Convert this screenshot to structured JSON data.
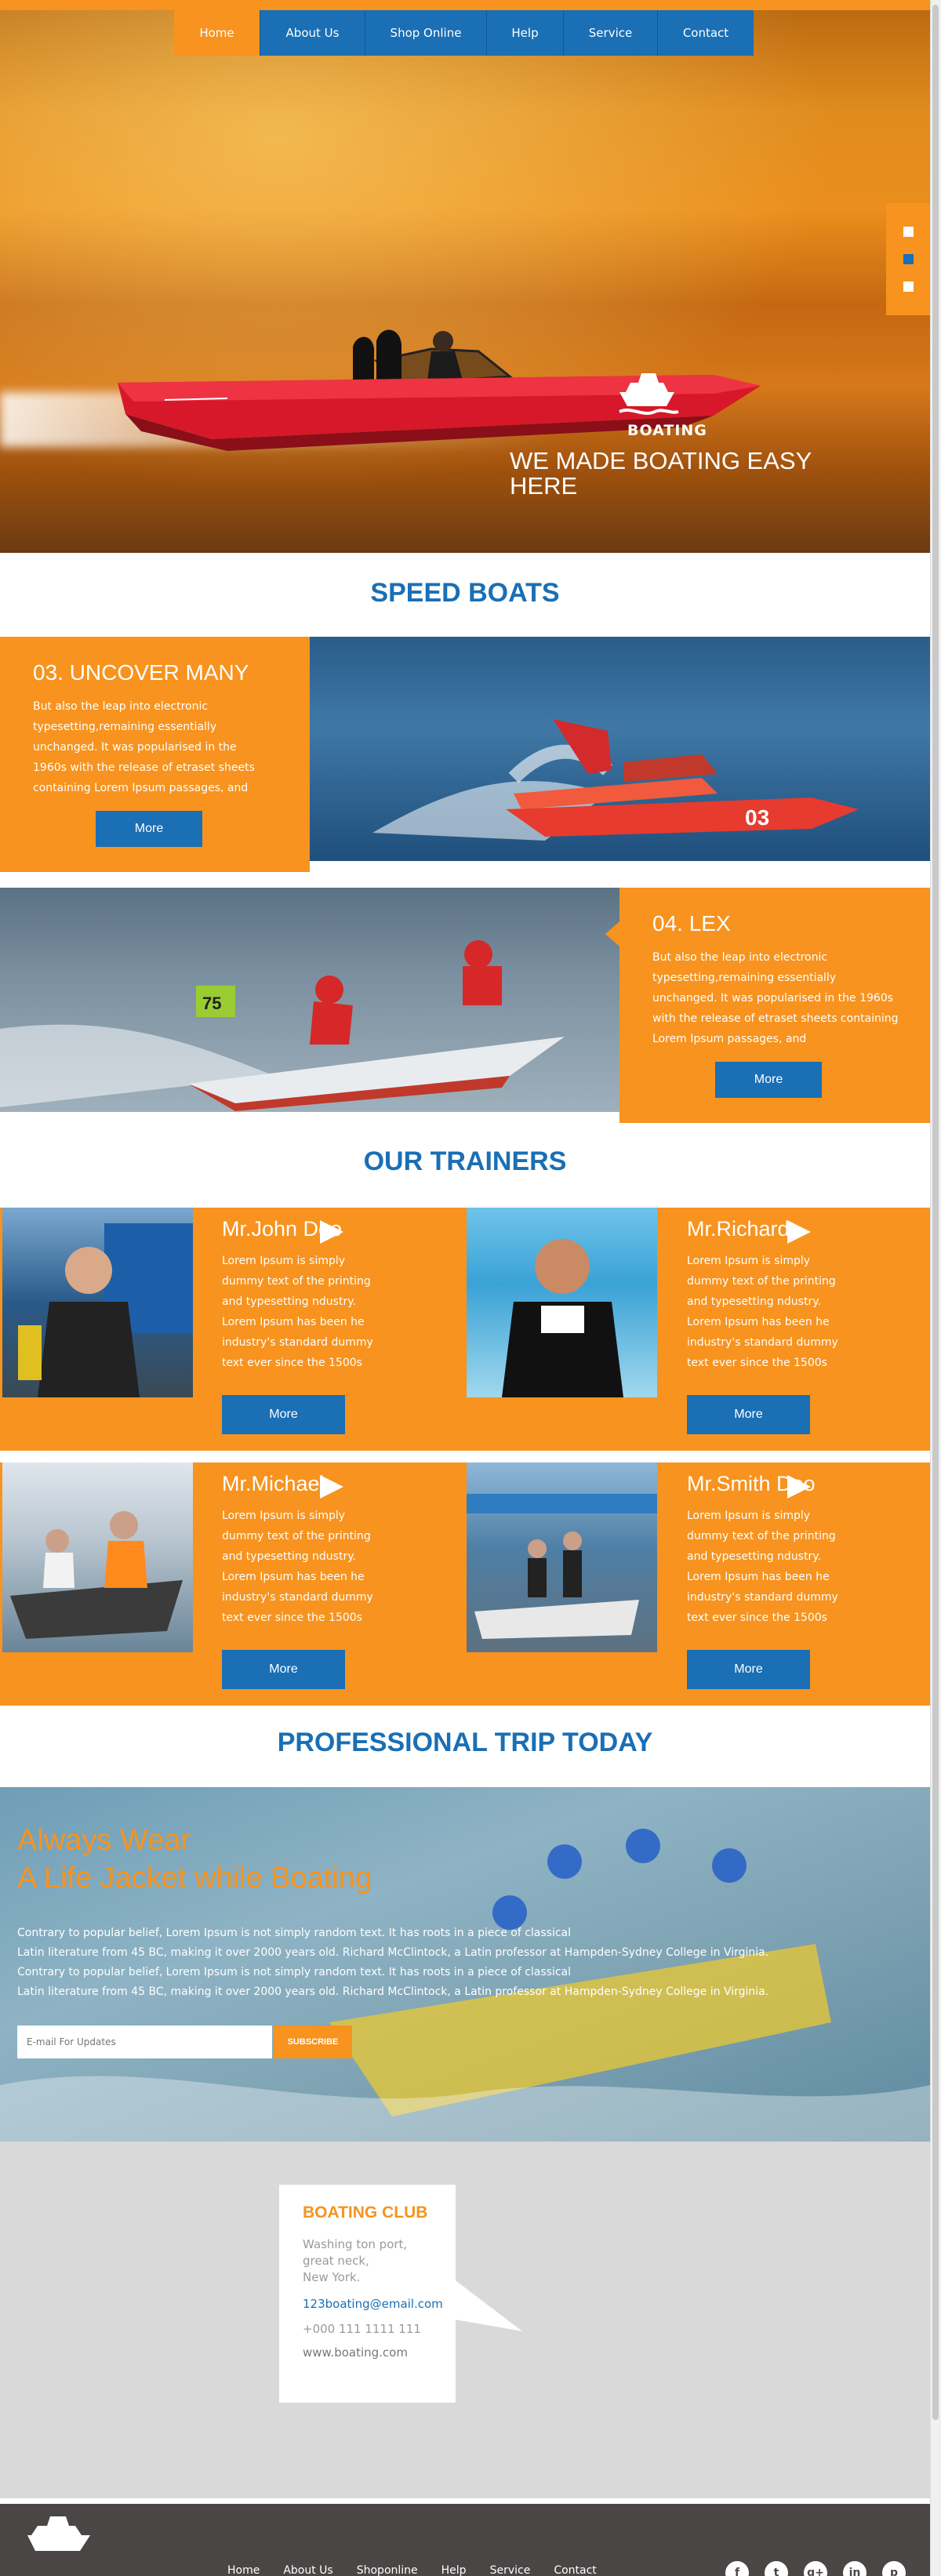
{
  "nav": {
    "items": [
      {
        "label": "Home",
        "active": true
      },
      {
        "label": "About Us",
        "active": false
      },
      {
        "label": "Shop Online",
        "active": false
      },
      {
        "label": "Help",
        "active": false
      },
      {
        "label": "Service",
        "active": false
      },
      {
        "label": "Contact",
        "active": false
      }
    ]
  },
  "hero": {
    "logo_text": "BOATING",
    "headline": "WE MADE BOATING EASY HERE",
    "slider_active_index": 1
  },
  "speed_boats": {
    "title": "SPEED BOATS",
    "rows": [
      {
        "heading": "03. UNCOVER MANY",
        "text": "But also the leap into electronic typesetting,remaining essentially unchanged. It was popularised in the 1960s with the release of etraset sheets containing Lorem Ipsum passages, and",
        "button": "More",
        "boat_number": "03"
      },
      {
        "heading": "04. LEX",
        "text": "But also the leap into electronic typesetting,remaining essentially unchanged. It was popularised in the 1960s with the release of etraset sheets containing Lorem Ipsum passages, and",
        "button": "More",
        "boat_number": "75"
      }
    ]
  },
  "trainers": {
    "title": "OUR TRAINERS",
    "items": [
      {
        "name": "Mr.John Deo",
        "text": "Lorem Ipsum is simply dummy text of the printing and typesetting ndustry. Lorem Ipsum has been he industry's standard dummy text ever since the 1500s",
        "button": "More"
      },
      {
        "name": "Mr.Richard",
        "text": "Lorem Ipsum is simply dummy text of the printing and typesetting ndustry. Lorem Ipsum has been he industry's standard dummy text ever since the 1500s",
        "button": "More"
      },
      {
        "name": "Mr.Michael",
        "text": "Lorem Ipsum is simply dummy text of the printing and typesetting ndustry. Lorem Ipsum has been he industry's standard dummy text ever since the 1500s",
        "button": "More"
      },
      {
        "name": "Mr.Smith Deo",
        "text": "Lorem Ipsum is simply dummy text of the printing and typesetting ndustry. Lorem Ipsum has been he industry's standard dummy text ever since the 1500s",
        "button": "More"
      }
    ]
  },
  "trip": {
    "title": "PROFESSIONAL TRIP TODAY",
    "headline_line1": "Always Wear",
    "headline_line2": "A Life Jacket while Boating",
    "paragraph_lines": [
      "Contrary to popular belief, Lorem Ipsum is not simply random text. It has roots in a piece of classical",
      "Latin literature from 45 BC, making it over 2000 years old. Richard McClintock, a Latin professor at Hampden-Sydney College in Virginia.",
      "Contrary to popular belief, Lorem Ipsum is not simply random text. It has roots in a piece of classical",
      "Latin literature from 45 BC, making it over 2000 years old. Richard McClintock, a Latin professor at Hampden-Sydney College in Virginia."
    ],
    "email_placeholder": "E-mail For Updates",
    "subscribe_label": "SUBSCRIBE"
  },
  "contact": {
    "title": "BOATING CLUB",
    "address_line1": "Washing ton port, great neck,",
    "address_line2": "New York.",
    "email": "123boating@email.com",
    "phone": "+000 111 1111 111",
    "website": "www.boating.com"
  },
  "footer": {
    "nav": [
      "Home",
      "About Us",
      "Shoponline",
      "Help",
      "Service",
      "Contact"
    ],
    "social_icons": [
      "facebook-icon",
      "twitter-icon",
      "google-plus-icon",
      "linkedin-icon",
      "pinterest-icon"
    ],
    "social_glyphs": [
      "f",
      "t",
      "g+",
      "in",
      "p"
    ]
  },
  "colors": {
    "orange": "#f7931e",
    "blue": "#1a6fb5",
    "footer": "#4a4646"
  }
}
